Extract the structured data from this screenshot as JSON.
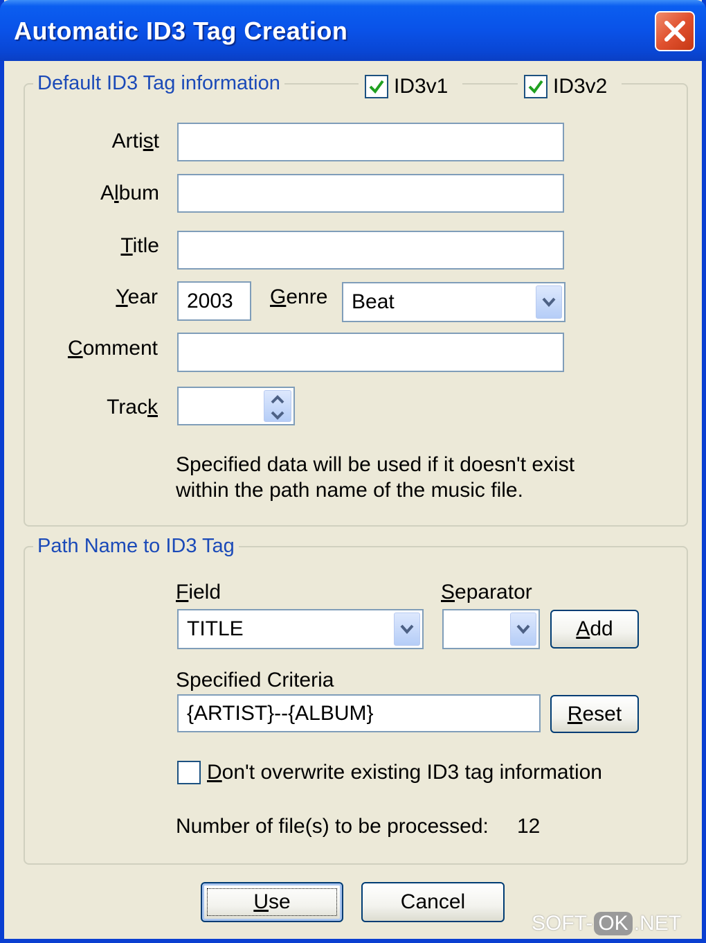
{
  "window": {
    "title": "Automatic ID3 Tag Creation"
  },
  "default_group": {
    "legend": "Default ID3 Tag information",
    "id3v1": {
      "label": "ID3v1",
      "checked": true
    },
    "id3v2": {
      "label": "ID3v2",
      "checked": true
    },
    "artist": {
      "label_pre": "Arti",
      "label_ul": "s",
      "label_post": "t",
      "value": ""
    },
    "album": {
      "label_pre": "A",
      "label_ul": "l",
      "label_post": "bum",
      "value": ""
    },
    "title": {
      "label_pre": "",
      "label_ul": "T",
      "label_post": "itle",
      "value": ""
    },
    "year": {
      "label_pre": "",
      "label_ul": "Y",
      "label_post": "ear",
      "value": "2003"
    },
    "genre": {
      "label_pre": "",
      "label_ul": "G",
      "label_post": "enre",
      "value": "Beat"
    },
    "comment": {
      "label_pre": "",
      "label_ul": "C",
      "label_post": "omment",
      "value": ""
    },
    "track": {
      "label_pre": "Trac",
      "label_ul": "k",
      "label_post": "",
      "value": ""
    },
    "note_line1": "Specified data will be used if it doesn't exist",
    "note_line2": "within the path name of the music file."
  },
  "path_group": {
    "legend": "Path Name to ID3 Tag",
    "field": {
      "label_pre": "",
      "label_ul": "F",
      "label_post": "ield",
      "value": "TITLE"
    },
    "separator": {
      "label_pre": "",
      "label_ul": "S",
      "label_post": "eparator",
      "value": ""
    },
    "add_button": {
      "label_pre": "",
      "label_ul": "A",
      "label_post": "dd"
    },
    "criteria": {
      "label": "Specified Criteria",
      "value": "{ARTIST}--{ALBUM}"
    },
    "reset_button": {
      "label_pre": "",
      "label_ul": "R",
      "label_post": "eset"
    },
    "dont_overwrite": {
      "label_pre": "",
      "label_ul": "D",
      "label_post": "on't overwrite existing ID3 tag information",
      "checked": false
    },
    "files_label": "Number of file(s) to be processed:",
    "files_count": "12"
  },
  "buttons": {
    "use": {
      "label_pre": "",
      "label_ul": "U",
      "label_post": "se"
    },
    "cancel": {
      "label": "Cancel"
    }
  },
  "watermark": {
    "pre": "SOFT-",
    "mid": "OK",
    "post": ".NET"
  },
  "colors": {
    "titlebar": "#0a52e8",
    "legend": "#1b4ab8",
    "dialog_bg": "#ece9d8",
    "check": "#21a121"
  }
}
